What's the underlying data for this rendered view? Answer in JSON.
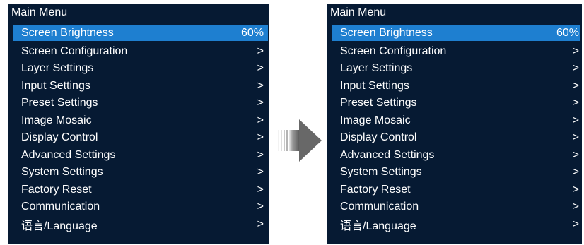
{
  "colors": {
    "screen_bg": "#061a33",
    "highlight": "#1e7fd0",
    "text": "#ffffff",
    "arrow": "#6e6e6e"
  },
  "left_screen": {
    "title": "Main Menu",
    "items": [
      {
        "label": "Screen Brightness",
        "value": "60%"
      },
      {
        "label": "Screen Configuration",
        "value": ">"
      },
      {
        "label": "Layer Settings",
        "value": ">"
      },
      {
        "label": "Input Settings",
        "value": ">"
      },
      {
        "label": "Preset Settings",
        "value": ">"
      },
      {
        "label": "Image Mosaic",
        "value": ">"
      },
      {
        "label": "Display Control",
        "value": ">"
      },
      {
        "label": "Advanced Settings",
        "value": ">"
      },
      {
        "label": "System Settings",
        "value": ">"
      },
      {
        "label": "Factory Reset",
        "value": ">"
      },
      {
        "label": "Communication",
        "value": ">"
      },
      {
        "label": "语言/Language",
        "value": ">"
      }
    ]
  },
  "right_screen": {
    "title": "Main Menu",
    "items": [
      {
        "label": "Screen Brightness",
        "value": "60%"
      },
      {
        "label": "Screen Configuration",
        "value": ">"
      },
      {
        "label": "Layer Settings",
        "value": ">"
      },
      {
        "label": "Input Settings",
        "value": ">"
      },
      {
        "label": "Preset Settings",
        "value": ">"
      },
      {
        "label": "Image Mosaic",
        "value": ">"
      },
      {
        "label": "Display Control",
        "value": ">"
      },
      {
        "label": "Advanced Settings",
        "value": ">"
      },
      {
        "label": "System Settings",
        "value": ">"
      },
      {
        "label": "Factory Reset",
        "value": ">"
      },
      {
        "label": "Communication",
        "value": ">"
      },
      {
        "label": "语言/Language",
        "value": ">"
      }
    ]
  },
  "transition_icon": "right-arrow-icon"
}
